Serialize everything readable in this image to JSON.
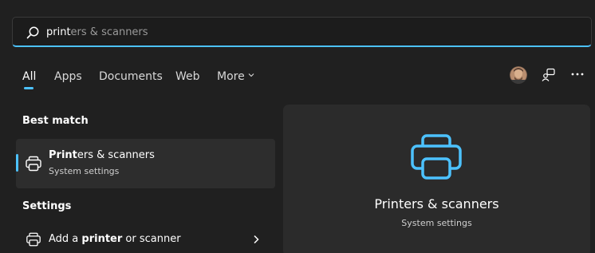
{
  "search": {
    "typed": "print",
    "suggestion": "ers & scanners"
  },
  "tabs": [
    {
      "label": "All",
      "active": true
    },
    {
      "label": "Apps"
    },
    {
      "label": "Documents"
    },
    {
      "label": "Web"
    },
    {
      "label": "More"
    }
  ],
  "header_icons": [
    "avatar",
    "share-icon",
    "more-options-icon"
  ],
  "best_match": {
    "heading": "Best match",
    "title_bold": "Print",
    "title_rest": "ers & scanners",
    "subtitle": "System settings",
    "icon": "printer-icon"
  },
  "settings": {
    "heading": "Settings",
    "items": [
      {
        "label_pre": "Add a ",
        "label_bold": "printer",
        "label_post": " or scanner",
        "icon": "printer-icon"
      }
    ]
  },
  "preview": {
    "title": "Printers & scanners",
    "subtitle": "System settings",
    "icon": "printer-icon"
  },
  "colors": {
    "background": "#202020",
    "accent": "#4cc2ff",
    "card": "#2d2d2d",
    "panel": "#2b2b2b"
  }
}
